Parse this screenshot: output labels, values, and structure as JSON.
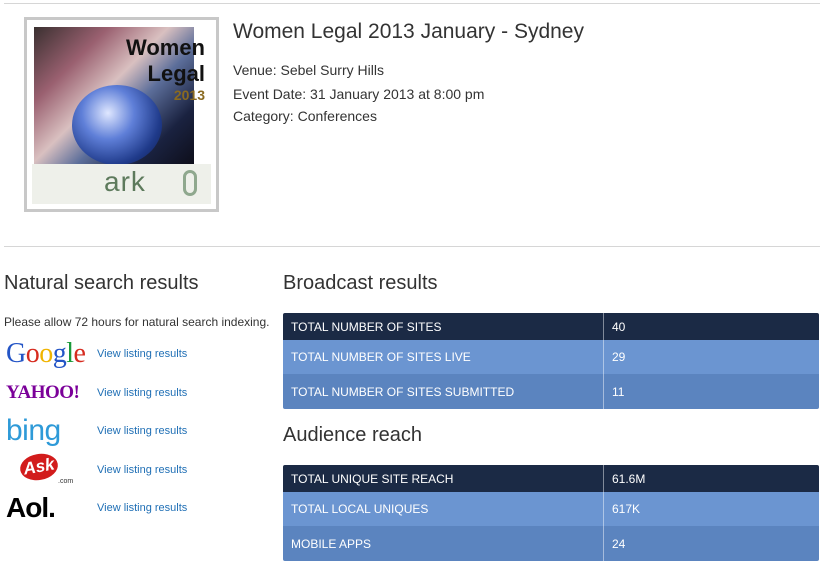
{
  "event": {
    "title": "Women Legal 2013 January - Sydney",
    "venue": "Venue: Sebel Surry Hills",
    "date": "Event Date: 31 January 2013 at 8:00 pm",
    "category": "Category: Conferences",
    "thumbnail": {
      "title_line1": "Women",
      "title_line2": "Legal",
      "year": "2013",
      "brand": "ark"
    }
  },
  "natural_search": {
    "heading": "Natural search results",
    "note": "Please allow 72 hours for natural search indexing.",
    "engines": [
      {
        "name": "Google",
        "link": "View listing results"
      },
      {
        "name": "YAHOO!",
        "link": "View listing results"
      },
      {
        "name": "bing",
        "link": "View listing results"
      },
      {
        "name": "Ask",
        "suffix": ".com",
        "link": "View listing results"
      },
      {
        "name": "Aol.",
        "link": "View listing results"
      }
    ]
  },
  "broadcast": {
    "heading": "Broadcast results",
    "rows": [
      {
        "label": "TOTAL NUMBER OF SITES",
        "value": "40"
      },
      {
        "label": "TOTAL NUMBER OF SITES LIVE",
        "value": "29"
      },
      {
        "label": "TOTAL NUMBER OF SITES SUBMITTED",
        "value": "11"
      }
    ]
  },
  "audience": {
    "heading": "Audience reach",
    "rows": [
      {
        "label": "TOTAL UNIQUE SITE REACH",
        "value": "61.6M"
      },
      {
        "label": "TOTAL LOCAL UNIQUES",
        "value": "617K"
      },
      {
        "label": "MOBILE APPS",
        "value": "24"
      }
    ]
  },
  "colors": {
    "table_header": "#1b2a45",
    "table_row_a": "#6b95d1",
    "table_row_b": "#5b84bf",
    "link": "#1f6fb5"
  }
}
